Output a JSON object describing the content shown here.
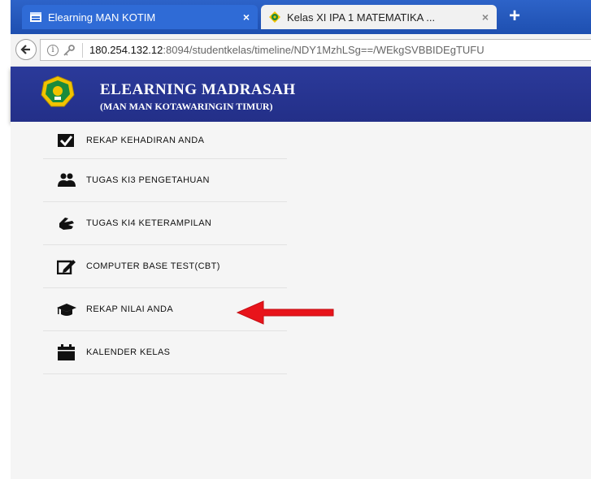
{
  "browser": {
    "tabs": [
      {
        "title": "Elearning MAN KOTIM",
        "icon": "window-icon",
        "close": "×"
      },
      {
        "title": "Kelas XI IPA 1 MATEMATIKA ...",
        "icon": "kemenag-logo-icon",
        "close": "×"
      }
    ],
    "new_tab_label": "+",
    "url_host": "180.254.132.12",
    "url_rest": ":8094/studentkelas/timeline/NDY1MzhLSg==/WEkgSVBBIDEgTUFU"
  },
  "site": {
    "title": "ELEARNING MADRASAH",
    "subtitle": "(MAN MAN KOTAWARINGIN TIMUR)",
    "header_color": "#27338f"
  },
  "menu": {
    "items": [
      {
        "label": "REKAP KEHADIRAN ANDA",
        "icon": "checkbox-icon"
      },
      {
        "label": "TUGAS KI3 PENGETAHUAN",
        "icon": "users-icon"
      },
      {
        "label": "TUGAS KI4 KETERAMPILAN",
        "icon": "hand-icon"
      },
      {
        "label": "COMPUTER BASE TEST(CBT)",
        "icon": "edit-icon"
      },
      {
        "label": "REKAP NILAI ANDA",
        "icon": "graduation-cap-icon"
      },
      {
        "label": "KALENDER KELAS",
        "icon": "calendar-icon"
      }
    ]
  },
  "annotation": {
    "arrow_color": "#e8141b",
    "points_to": "REKAP NILAI ANDA"
  }
}
